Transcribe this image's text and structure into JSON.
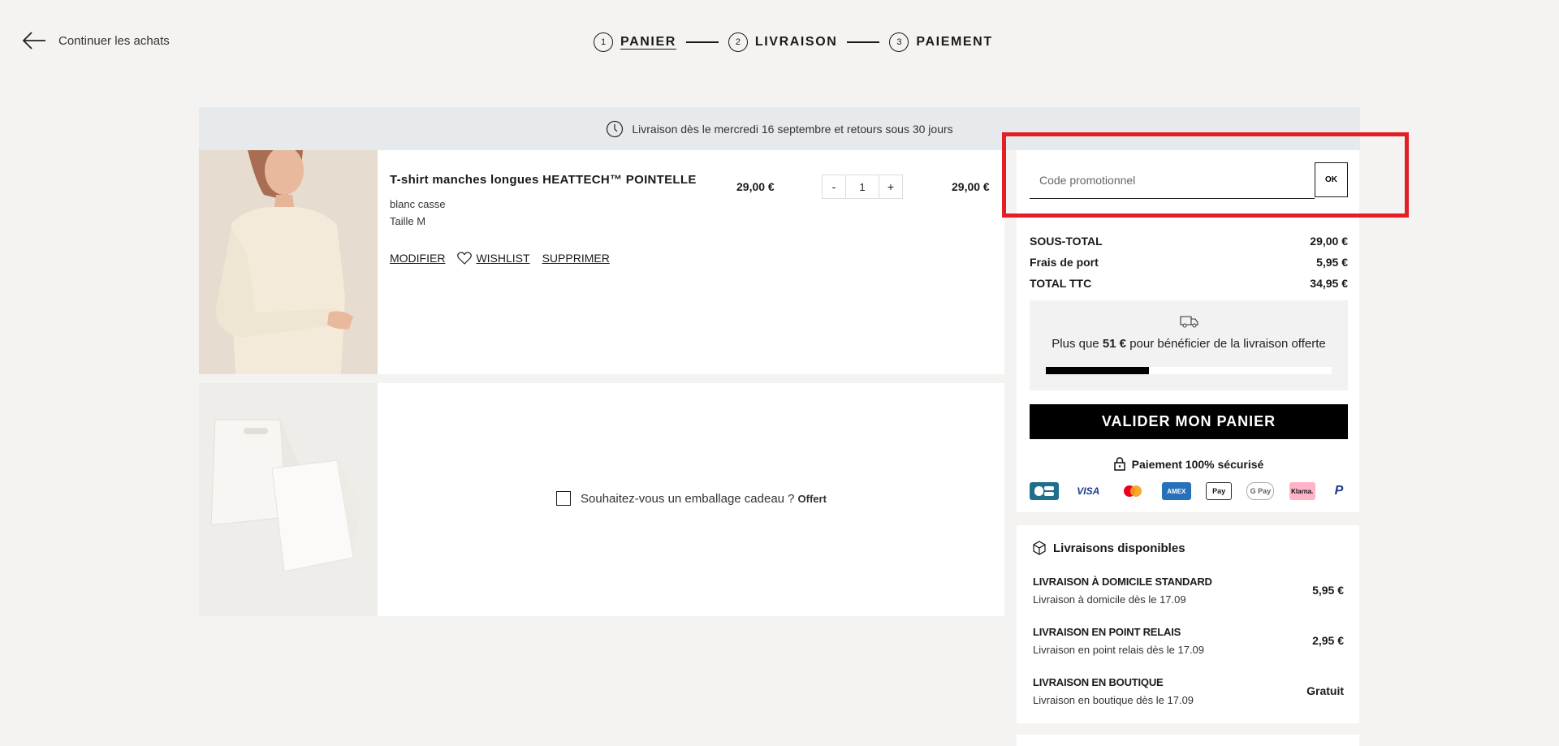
{
  "header": {
    "back_label": "Continuer les achats",
    "steps": [
      {
        "num": "1",
        "label": "PANIER"
      },
      {
        "num": "2",
        "label": "LIVRAISON"
      },
      {
        "num": "3",
        "label": "PAIEMENT"
      }
    ]
  },
  "banner": {
    "text": "Livraison dès le mercredi 16 septembre et retours sous 30 jours"
  },
  "product": {
    "name": "T-shirt manches longues HEATTECH™ POINTELLE",
    "color": "blanc casse",
    "size": "Taille M",
    "unit_price": "29,00 €",
    "quantity": "1",
    "qty_minus": "-",
    "qty_plus": "+",
    "total": "29,00 €",
    "actions": {
      "modify": "MODIFIER",
      "wishlist": "WISHLIST",
      "delete": "SUPPRIMER"
    }
  },
  "gift": {
    "label": "Souhaitez-vous un emballage cadeau ?",
    "offer": "Offert"
  },
  "summary": {
    "promo_placeholder": "Code promotionnel",
    "ok_label": "OK",
    "subtotal_label": "SOUS-TOTAL",
    "subtotal_value": "29,00 €",
    "shipping_label": "Frais de port",
    "shipping_value": "5,95 €",
    "total_label": "TOTAL TTC",
    "total_value": "34,95 €",
    "free_shipping_prefix": "Plus que",
    "free_shipping_amount": "51 €",
    "free_shipping_suffix": "pour bénéficier de la livraison offerte",
    "free_shipping_progress": 0.36,
    "validate_label": "VALIDER MON PANIER",
    "secure_label": "Paiement 100% sécurisé",
    "payment_methods": [
      "cb",
      "visa",
      "mastercard",
      "amex",
      "apple-pay",
      "google-pay",
      "klarna",
      "paypal"
    ]
  },
  "delivery": {
    "title": "Livraisons disponibles",
    "options": [
      {
        "name": "LIVRAISON À DOMICILE STANDARD",
        "sub": "Livraison à domicile dès le 17.09",
        "price": "5,95 €"
      },
      {
        "name": "LIVRAISON EN POINT RELAIS",
        "sub": "Livraison en point relais dès le 17.09",
        "price": "2,95 €"
      },
      {
        "name": "LIVRAISON EN BOUTIQUE",
        "sub": "Livraison en boutique dès le 17.09",
        "price": "Gratuit"
      }
    ]
  },
  "colors": {
    "accent": "#000000",
    "highlight": "#e31e24",
    "banner_bg": "#e7eaec",
    "page_bg": "#f4f3f1"
  }
}
